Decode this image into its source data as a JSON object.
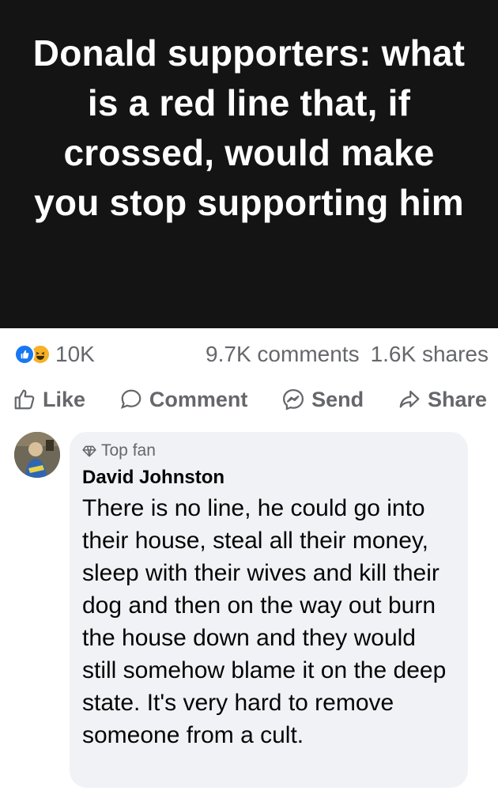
{
  "post": {
    "title": "Donald supporters: what is a red line that, if crossed, would make you stop supporting him"
  },
  "stats": {
    "reaction_count": "10K",
    "comments": "9.7K comments",
    "shares": "1.6K shares",
    "reaction_icons": [
      "like-icon",
      "haha-icon"
    ]
  },
  "actions": {
    "like": "Like",
    "comment": "Comment",
    "send": "Send",
    "share": "Share"
  },
  "comment": {
    "badge": "Top fan",
    "author": "David Johnston",
    "text": "There is no line, he could go into their house, steal all their money, sleep with their wives and kill their dog and then on the way out burn the house down and they would still somehow blame it on the deep state. It's very hard to remove someone from a cult."
  },
  "colors": {
    "header_bg": "#141414",
    "like_blue": "#1877f2",
    "haha_yellow": "#f7b125",
    "muted_text": "#65676b",
    "bubble_bg": "#f0f2f5"
  }
}
